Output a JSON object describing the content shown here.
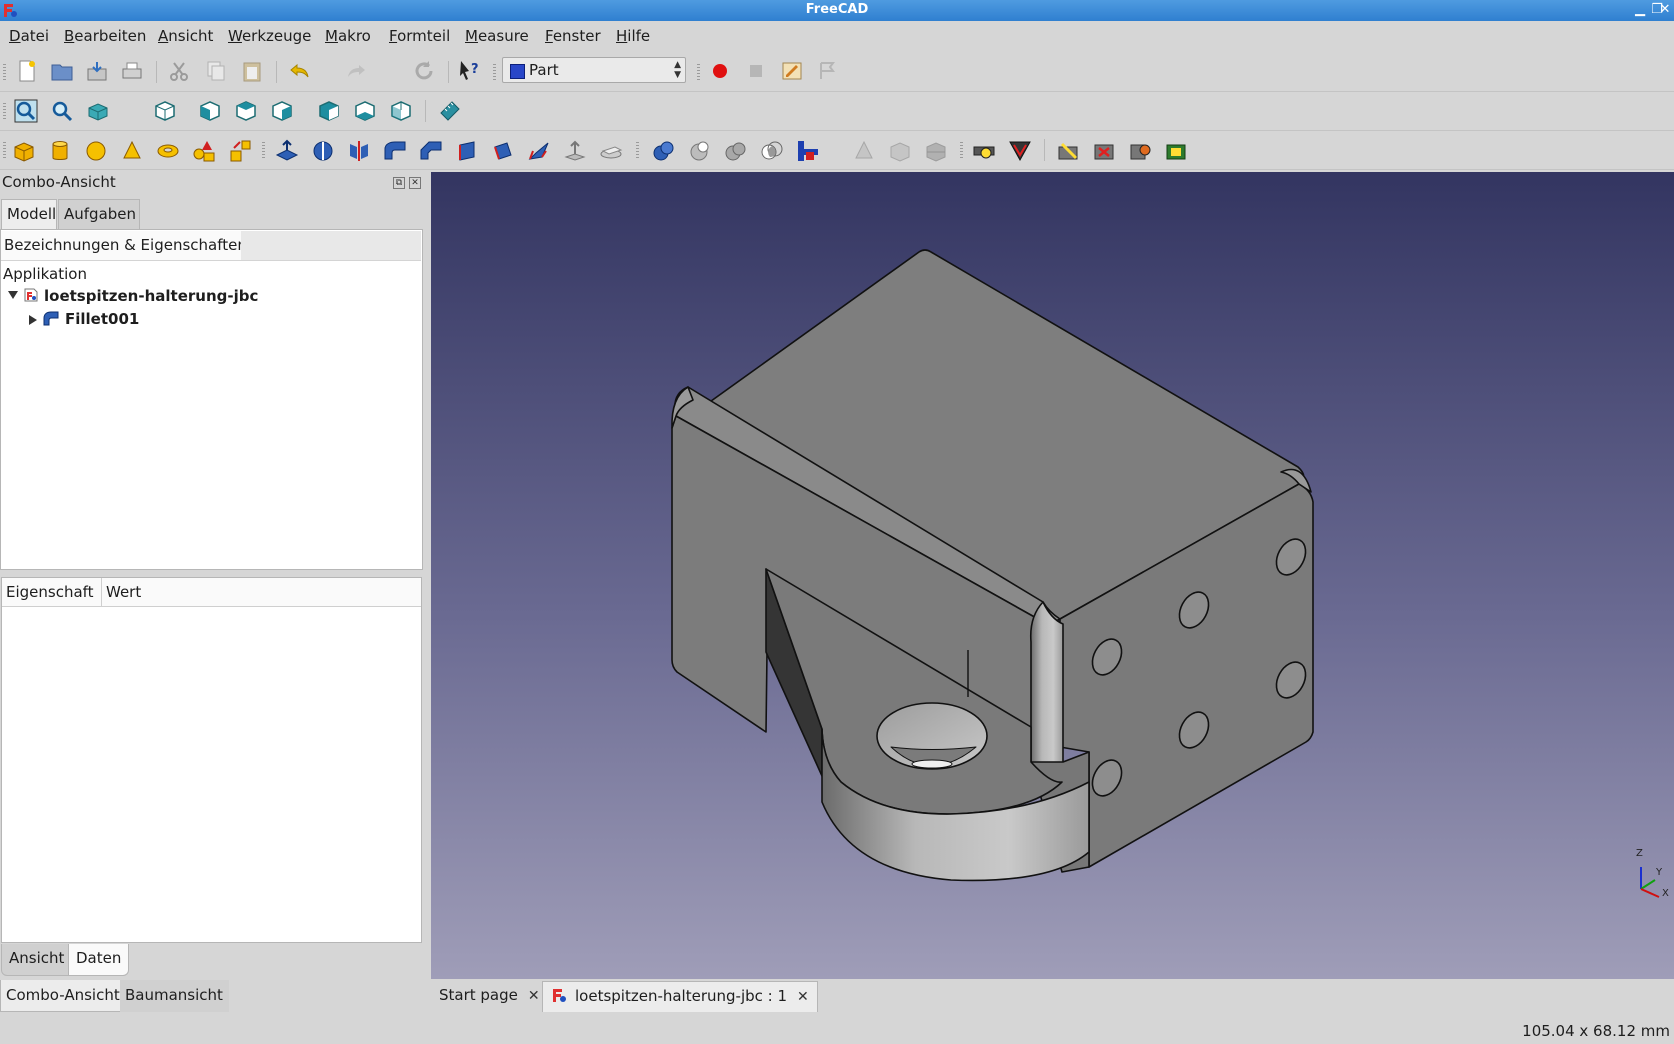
{
  "window": {
    "title": "FreeCAD"
  },
  "menu": [
    "Datei",
    "Bearbeiten",
    "Ansicht",
    "Werkzeuge",
    "Makro",
    "Formteil",
    "Measure",
    "Fenster",
    "Hilfe"
  ],
  "toolbar": {
    "workbench": "Part"
  },
  "combo_view": {
    "title": "Combo-Ansicht",
    "tabs": [
      "Modell",
      "Aufgaben"
    ],
    "tree_header": "Bezeichnungen & Eigenschaften",
    "tree": {
      "root": "Applikation",
      "document": "loetspitzen-halterung-jbc",
      "child": "Fillet001"
    },
    "properties": {
      "col_property": "Eigenschaft",
      "col_value": "Wert"
    },
    "bottom_tabs": [
      "Ansicht",
      "Daten"
    ]
  },
  "dock_tabs": [
    "Combo-Ansicht",
    "Baumansicht"
  ],
  "document_tabs": [
    "Start page",
    "loetspitzen-halterung-jbc : 1"
  ],
  "axis_labels": {
    "z": "Z",
    "y": "Y",
    "x": "X"
  },
  "status": {
    "dimensions": "105.04 x 68.12 mm"
  }
}
